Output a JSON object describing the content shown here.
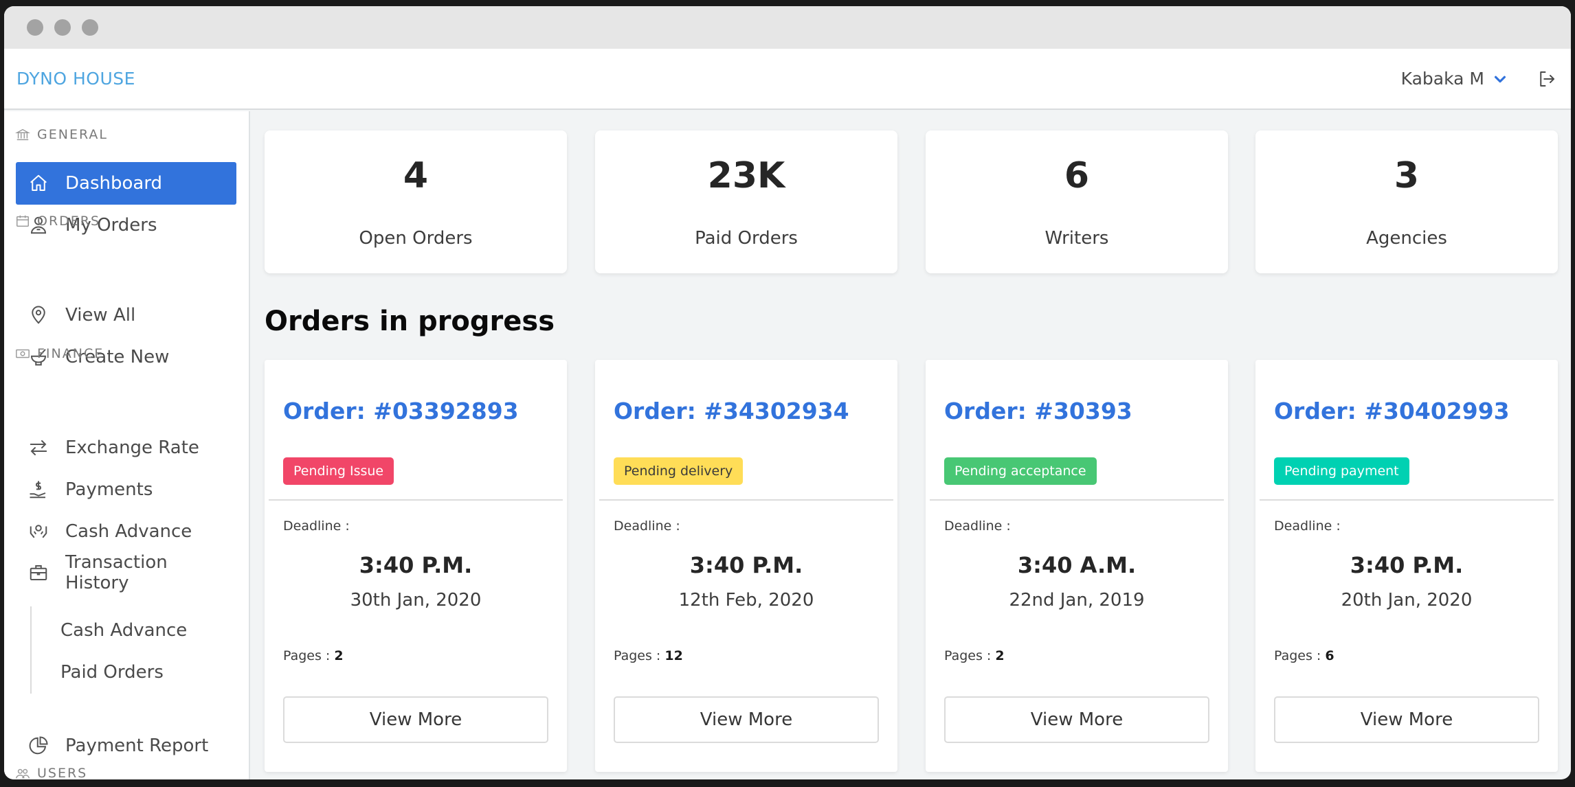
{
  "app": {
    "brand": "DYNO HOUSE",
    "user_name": "Kabaka M"
  },
  "sidebar": {
    "sections": [
      {
        "label": "GENERAL",
        "icon": "bank-icon"
      },
      {
        "label": "ORDERS",
        "icon": "calendar-icon"
      },
      {
        "label": "FINANCE",
        "icon": "money-icon"
      },
      {
        "label": "USERS",
        "icon": "users-icon"
      }
    ],
    "items": [
      {
        "label": "Dashboard",
        "icon": "home-icon",
        "active": true
      },
      {
        "label": "My Orders",
        "icon": "user-orders-icon"
      },
      {
        "label": "View All",
        "icon": "map-pin-icon"
      },
      {
        "label": "Create New",
        "icon": "mortar-icon"
      },
      {
        "label": "Exchange Rate",
        "icon": "exchange-icon"
      },
      {
        "label": "Payments",
        "icon": "hand-dollar-icon"
      },
      {
        "label": "Cash Advance",
        "icon": "hands-coin-icon"
      },
      {
        "label": "Transaction History",
        "icon": "briefcase-icon"
      },
      {
        "label": "Payment Report",
        "icon": "pie-chart-icon"
      }
    ],
    "submenu": [
      "Cash Advance",
      "Paid Orders"
    ]
  },
  "stats": [
    {
      "value": "4",
      "label": "Open Orders"
    },
    {
      "value": "23K",
      "label": "Paid Orders"
    },
    {
      "value": "6",
      "label": "Writers"
    },
    {
      "value": "3",
      "label": "Agencies"
    }
  ],
  "section_title": "Orders in progress",
  "orders": [
    {
      "title": "Order: #03392893",
      "status": "Pending Issue",
      "status_color": "#f14668",
      "status_text_color": "#ffffff",
      "deadline_label": "Deadline :",
      "time": "3:40 P.M.",
      "date": "30th Jan, 2020",
      "pages_label": "Pages : ",
      "pages": "2",
      "button": "View More"
    },
    {
      "title": "Order: #34302934",
      "status": "Pending delivery",
      "status_color": "#ffdd57",
      "status_text_color": "#3a3a3a",
      "deadline_label": "Deadline :",
      "time": "3:40 P.M.",
      "date": "12th Feb, 2020",
      "pages_label": "Pages : ",
      "pages": "12",
      "button": "View More"
    },
    {
      "title": "Order: #30393",
      "status": "Pending acceptance",
      "status_color": "#48c774",
      "status_text_color": "#ffffff",
      "deadline_label": "Deadline :",
      "time": "3:40 A.M.",
      "date": "22nd Jan, 2019",
      "pages_label": "Pages : ",
      "pages": "2",
      "button": "View More"
    },
    {
      "title": "Order: #30402993",
      "status": "Pending payment",
      "status_color": "#00d1b2",
      "status_text_color": "#ffffff",
      "deadline_label": "Deadline :",
      "time": "3:40 P.M.",
      "date": "20th Jan, 2020",
      "pages_label": "Pages : ",
      "pages": "6",
      "button": "View More"
    }
  ]
}
